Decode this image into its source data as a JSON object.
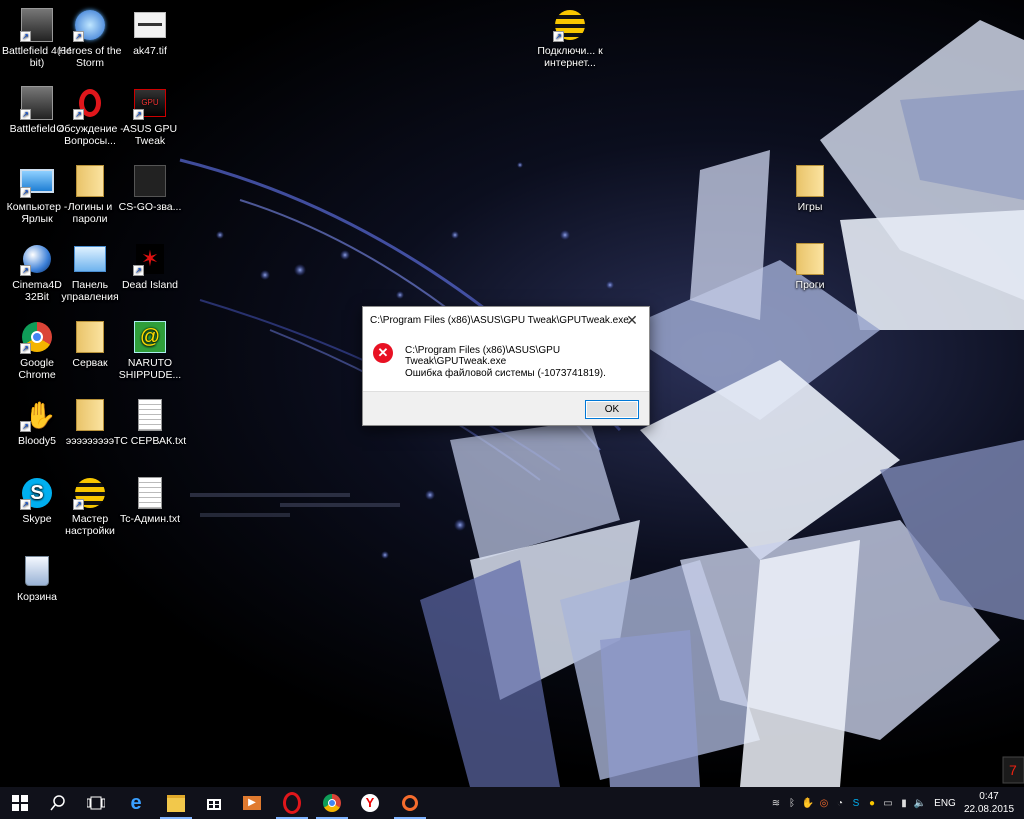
{
  "desktop": {
    "icons": [
      {
        "label": "Battlefield 4(64 bit)",
        "icon": "battlefield-icon"
      },
      {
        "label": "Heroes of the Storm",
        "icon": "heroes-icon"
      },
      {
        "label": "ak47.tif",
        "icon": "image-file-icon"
      },
      {
        "label": "Подключи... к интернет...",
        "icon": "beeline-icon"
      },
      {
        "label": "Battlefield 4",
        "icon": "battlefield-icon"
      },
      {
        "label": "Обсуждение - Вопросы...",
        "icon": "opera-icon"
      },
      {
        "label": "ASUS GPU Tweak",
        "icon": "gpu-tweak-icon"
      },
      {
        "label": "Компьютер - Ярлык",
        "icon": "computer-icon"
      },
      {
        "label": "Логины и пароли",
        "icon": "folder-icon"
      },
      {
        "label": "CS-GO-зва...",
        "icon": "video-file-icon"
      },
      {
        "label": "Игры",
        "icon": "folder-icon"
      },
      {
        "label": "Cinema4D 32Bit",
        "icon": "cinema4d-icon"
      },
      {
        "label": "Панель управления",
        "icon": "control-panel-icon"
      },
      {
        "label": "Dead Island",
        "icon": "dead-island-icon"
      },
      {
        "label": "Проги",
        "icon": "folder-icon"
      },
      {
        "label": "Google Chrome",
        "icon": "chrome-icon"
      },
      {
        "label": "Сервак",
        "icon": "folder-icon"
      },
      {
        "label": "NARUTO SHIPPUDE...",
        "icon": "naruto-icon"
      },
      {
        "label": "Bloody5",
        "icon": "bloody-icon"
      },
      {
        "label": "эээээээээ",
        "icon": "folder-icon"
      },
      {
        "label": "TC СЕРВАК.txt",
        "icon": "text-file-icon"
      },
      {
        "label": "Skype",
        "icon": "skype-icon"
      },
      {
        "label": "Мастер настройки",
        "icon": "beeline-icon"
      },
      {
        "label": "Tc-Админ.txt",
        "icon": "text-file-icon"
      },
      {
        "label": "Корзина",
        "icon": "recycle-bin-icon"
      }
    ]
  },
  "dialog": {
    "title": "C:\\Program Files (x86)\\ASUS\\GPU Tweak\\GPUTweak.exe",
    "message_path": "C:\\Program Files (x86)\\ASUS\\GPU Tweak\\GPUTweak.exe",
    "message_error": "Ошибка файловой системы (-1073741819).",
    "ok_label": "OK",
    "close_glyph": "✕",
    "error_glyph": "✕"
  },
  "taskbar": {
    "pinned": [
      "windows-start-icon",
      "search-icon",
      "task-view-icon",
      "edge-icon",
      "file-explorer-icon",
      "store-icon",
      "media-player-icon",
      "opera-icon",
      "chrome-icon",
      "yandex-icon",
      "origin-icon"
    ],
    "language": "ENG",
    "time": "0:47",
    "date": "22.08.2015"
  },
  "colors": {
    "taskbar_bg": "#10111a",
    "error_red": "#e81123",
    "accent": "#0078d7"
  }
}
